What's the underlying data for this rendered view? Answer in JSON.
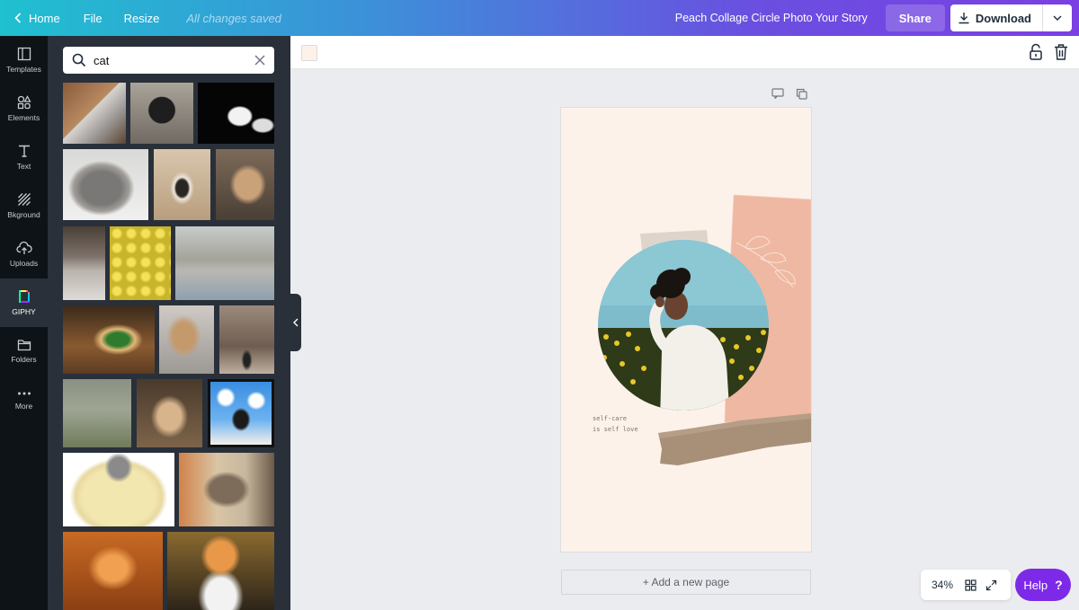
{
  "topbar": {
    "home": "Home",
    "file": "File",
    "resize": "Resize",
    "saved_status": "All changes saved",
    "doc_title": "Peach Collage Circle Photo Your Story",
    "share": "Share",
    "download": "Download"
  },
  "rail": {
    "items": [
      {
        "label": "Templates",
        "icon": "templates-icon"
      },
      {
        "label": "Elements",
        "icon": "elements-icon"
      },
      {
        "label": "Text",
        "icon": "text-icon"
      },
      {
        "label": "Bkground",
        "icon": "background-icon"
      },
      {
        "label": "Uploads",
        "icon": "uploads-icon"
      },
      {
        "label": "GIPHY",
        "icon": "giphy-icon",
        "active": true
      },
      {
        "label": "Folders",
        "icon": "folders-icon"
      },
      {
        "label": "More",
        "icon": "more-icon"
      }
    ]
  },
  "search": {
    "value": "cat"
  },
  "canvas": {
    "background_color": "#fdf2ea",
    "caption_line1": "self-care",
    "caption_line2": "is self love"
  },
  "editor": {
    "add_page": "+ Add a new page",
    "zoom": "34%",
    "help": "Help",
    "help_mark": "?"
  },
  "colors": {
    "accent": "#7d2ae8",
    "panel": "#293039",
    "rail": "#0e1318"
  }
}
